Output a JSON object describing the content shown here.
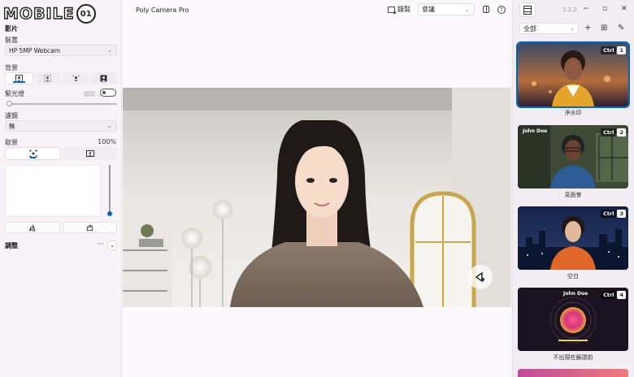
{
  "brand": {
    "logo_text": "MOBILE",
    "logo_badge": "01"
  },
  "window": {
    "title": "Poly Camera Pro",
    "record_label": "錄製",
    "mode_value": "會議",
    "version": "2.2.2"
  },
  "left_panel": {
    "section_title": "影片",
    "device_label": "裝置",
    "device_value": "HP 5MP Webcam",
    "background_label": "背景",
    "light_label": "緊光燈",
    "light_state": "關閉",
    "filter_label": "濾鏡",
    "filter_value": "無",
    "framing_label": "取景",
    "zoom_value": "100%",
    "adjust_label": "調整",
    "adjust_more": "···"
  },
  "right_panel": {
    "filter_value": "全部",
    "scenes": [
      {
        "label": "淨水印",
        "key": "Ctrl",
        "num": "1"
      },
      {
        "label": "見面會",
        "key": "Ctrl",
        "num": "2",
        "name": "John Doe"
      },
      {
        "label": "空白",
        "key": "Ctrl",
        "num": "3"
      },
      {
        "label": "不出現在鏡頭前",
        "key": "Ctrl",
        "num": "4",
        "name": "John Doe"
      }
    ]
  },
  "icons": {
    "chevron": "chevron-down-icon",
    "record": "record-icon",
    "split": "split-view-icon",
    "help": "help-icon"
  },
  "colors": {
    "accent": "#0067c0"
  }
}
